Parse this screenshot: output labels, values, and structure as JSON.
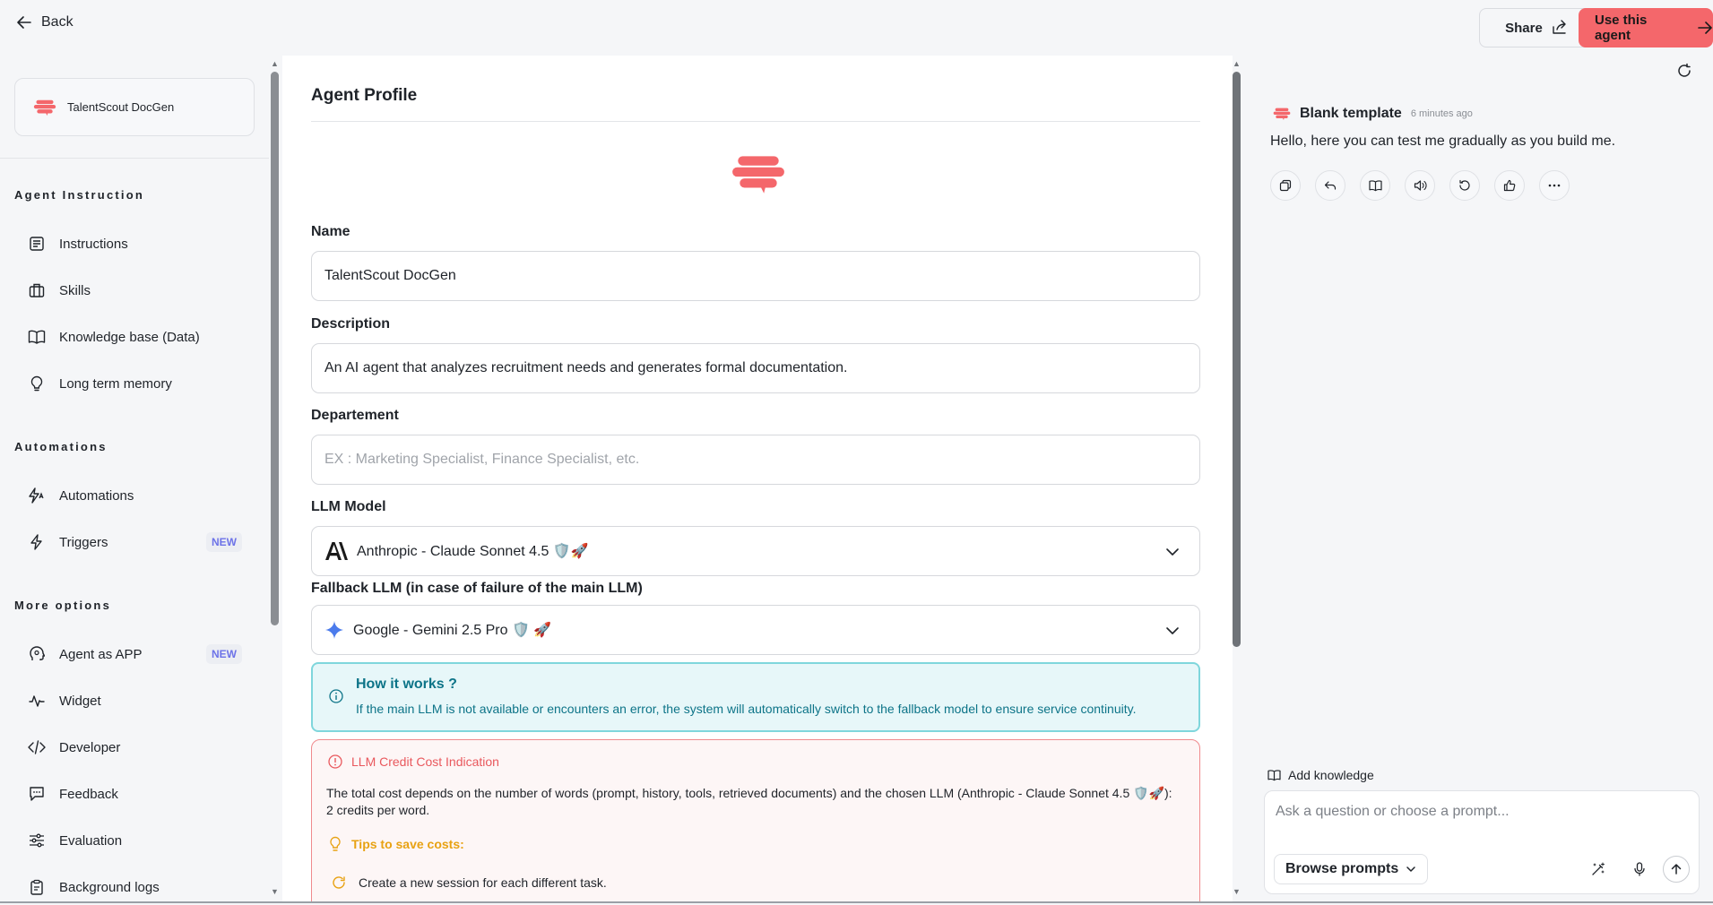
{
  "topbar": {
    "back_label": "Back",
    "share_label": "Share",
    "use_agent_label": "Use this agent"
  },
  "sidebar": {
    "agent_name": "TalentScout DocGen",
    "sections": [
      {
        "title": "Agent Instruction",
        "items": [
          {
            "label": "Instructions",
            "icon": "instructions-icon"
          },
          {
            "label": "Skills",
            "icon": "briefcase-icon"
          },
          {
            "label": "Knowledge base (Data)",
            "icon": "book-icon"
          },
          {
            "label": "Long term memory",
            "icon": "lightbulb-icon"
          }
        ]
      },
      {
        "title": "Automations",
        "items": [
          {
            "label": "Automations",
            "icon": "automation-icon"
          },
          {
            "label": "Triggers",
            "icon": "lightning-icon",
            "badge": "NEW"
          }
        ]
      },
      {
        "title": "More options",
        "items": [
          {
            "label": "Agent as APP",
            "icon": "head-icon",
            "badge": "NEW"
          },
          {
            "label": "Widget",
            "icon": "activity-icon"
          },
          {
            "label": "Developer",
            "icon": "code-icon"
          },
          {
            "label": "Feedback",
            "icon": "feedback-icon"
          },
          {
            "label": "Evaluation",
            "icon": "sliders-icon"
          },
          {
            "label": "Background logs",
            "icon": "clipboard-icon"
          }
        ]
      }
    ]
  },
  "main": {
    "title": "Agent Profile",
    "name_label": "Name",
    "name_value": "TalentScout DocGen",
    "description_label": "Description",
    "description_value": "An AI agent that analyzes recruitment needs and generates formal documentation.",
    "department_label": "Departement",
    "department_placeholder": "EX : Marketing Specialist, Finance Specialist, etc.",
    "department_value": "",
    "llm_label": "LLM Model",
    "llm_value": "Anthropic - Claude Sonnet 4.5 🛡️🚀",
    "fallback_label": "Fallback LLM (in case of failure of the main LLM)",
    "fallback_value": "Google - Gemini 2.5 Pro 🛡️ 🚀",
    "info_title": "How it works ?",
    "info_text": "If the main LLM is not available or encounters an error, the system will automatically switch to the fallback model to ensure service continuity.",
    "cost_title": "LLM Credit Cost Indication",
    "cost_text": "The total cost depends on the number of words (prompt, history, tools, retrieved documents) and the chosen LLM (Anthropic - Claude Sonnet 4.5 🛡️🚀): 2 credits per word.",
    "tips_title": "Tips to save costs:",
    "tip_1": "Create a new session for each different task."
  },
  "chat": {
    "author": "Blank template",
    "time": "6 minutes ago",
    "message": "Hello, here you can test me gradually as you build me.",
    "add_knowledge_label": "Add knowledge",
    "input_placeholder": "Ask a question or choose a prompt...",
    "browse_prompts_label": "Browse prompts"
  },
  "colors": {
    "brand": "#f4676b",
    "info_bg": "#e7f7f9",
    "info_text": "#0d7488",
    "cost_border": "#f08a8d",
    "tips": "#e8a213"
  }
}
